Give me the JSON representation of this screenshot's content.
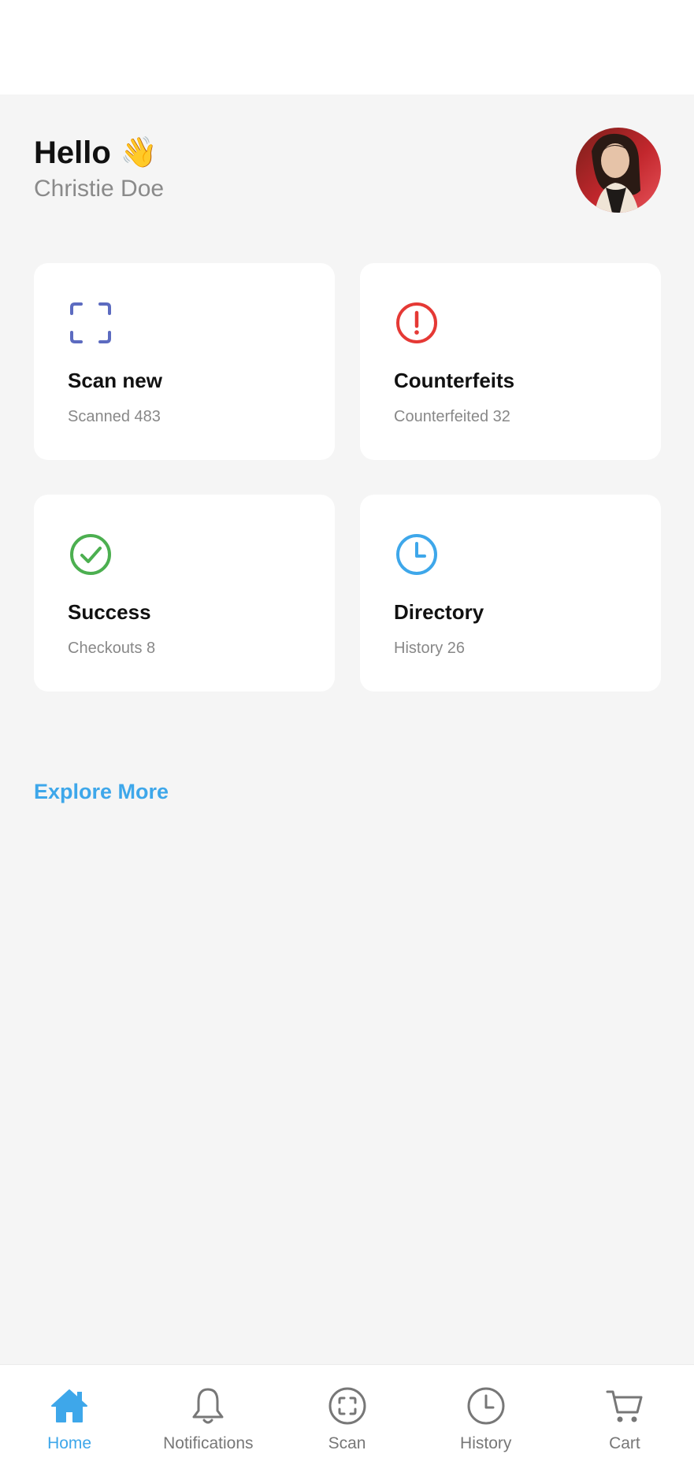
{
  "greeting": {
    "hello": "Hello",
    "wave_emoji": "👋",
    "name": "Christie Doe"
  },
  "cards": [
    {
      "title": "Scan new",
      "subtitle": "Scanned 483",
      "icon": "scan-frame-icon",
      "color": "#5c6bc0"
    },
    {
      "title": "Counterfeits",
      "subtitle": "Counterfeited 32",
      "icon": "alert-circle-icon",
      "color": "#e53935"
    },
    {
      "title": "Success",
      "subtitle": "Checkouts 8",
      "icon": "check-circle-icon",
      "color": "#4caf50"
    },
    {
      "title": "Directory",
      "subtitle": "History 26",
      "icon": "clock-icon",
      "color": "#3ea7ea"
    }
  ],
  "explore_label": "Explore More",
  "nav": {
    "active": "Home",
    "items": [
      {
        "label": "Home",
        "icon": "home-icon"
      },
      {
        "label": "Notifications",
        "icon": "bell-icon"
      },
      {
        "label": "Scan",
        "icon": "scan-icon"
      },
      {
        "label": "History",
        "icon": "clock-icon"
      },
      {
        "label": "Cart",
        "icon": "cart-icon"
      }
    ]
  },
  "colors": {
    "accent": "#3ea7ea",
    "background": "#f5f5f5",
    "inactive": "#777777"
  }
}
